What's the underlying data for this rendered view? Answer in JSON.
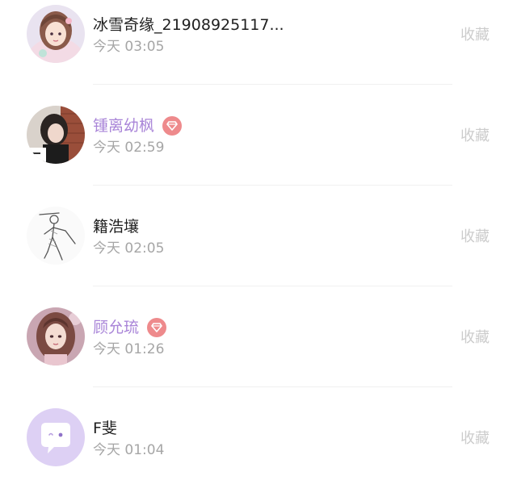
{
  "colors": {
    "name_default": "#1f1f1f",
    "name_vip": "#a985d8",
    "time": "#a6a6a6",
    "favorite": "#cccccc",
    "vip_badge": "#ee8a8c"
  },
  "list": {
    "items": [
      {
        "name": "冰雪奇缘_21908925117...",
        "time": "今天 03:05",
        "favorite_label": "收藏",
        "vip": false,
        "avatar_icon": "anime-girl-avatar"
      },
      {
        "name": "锺离幼枫",
        "time": "今天 02:59",
        "favorite_label": "收藏",
        "vip": true,
        "avatar_icon": "photo-girl-avatar"
      },
      {
        "name": "籍浩壤",
        "time": "今天 02:05",
        "favorite_label": "收藏",
        "vip": false,
        "avatar_icon": "sketch-figure-avatar"
      },
      {
        "name": "顾允琉",
        "time": "今天 01:26",
        "favorite_label": "收藏",
        "vip": true,
        "avatar_icon": "illustrated-girl-avatar"
      },
      {
        "name": "F斐",
        "time": "今天 01:04",
        "favorite_label": "收藏",
        "vip": false,
        "avatar_icon": "chat-bubble-avatar"
      }
    ]
  }
}
